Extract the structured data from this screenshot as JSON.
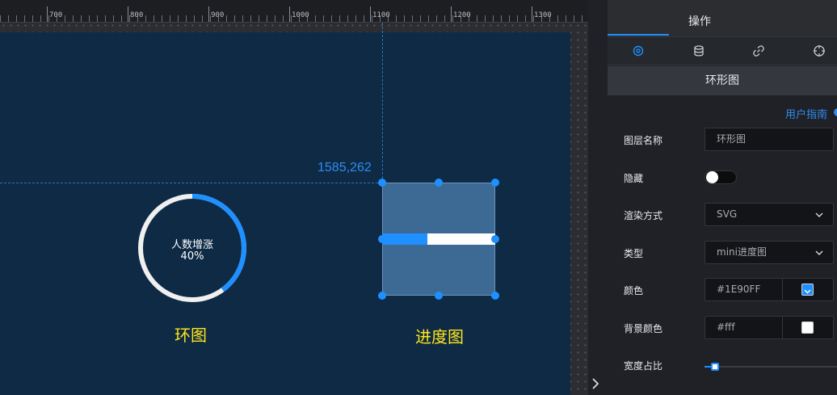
{
  "ruler": {
    "labels": [
      "700",
      "800",
      "900",
      "1000",
      "1100",
      "1200",
      "1300"
    ]
  },
  "canvas": {
    "coordinate_readout": "1585,262",
    "ring_chart": {
      "title": "人数增涨",
      "value_text": "40%",
      "percent": 0.4,
      "fill_color": "#1e90ff",
      "track_color": "#f0f0f0"
    },
    "progress_chart": {
      "percent": 0.4,
      "fill_color": "#1E90FF",
      "bg_color": "#fff"
    },
    "captions": {
      "ring": "环图",
      "progress": "进度图"
    },
    "caption_color": "#ffe51a",
    "background": "#0e2a45"
  },
  "panel": {
    "tab_label": "操作",
    "icons": [
      "settings-icon",
      "database-icon",
      "link-icon",
      "crosshair-icon"
    ],
    "section_title": "环形图",
    "user_guide": "用户指南",
    "fields": {
      "layer_name": {
        "label": "图层名称",
        "placeholder": "环形图"
      },
      "hidden": {
        "label": "隐藏",
        "value": false
      },
      "render_mode": {
        "label": "渲染方式",
        "value": "SVG"
      },
      "type": {
        "label": "类型",
        "value": "mini进度图"
      },
      "color": {
        "label": "颜色",
        "value": "#1E90FF"
      },
      "bg_color": {
        "label": "背景颜色",
        "value": "#fff"
      },
      "width_ratio": {
        "label": "宽度占比",
        "value": 0.08
      }
    }
  }
}
